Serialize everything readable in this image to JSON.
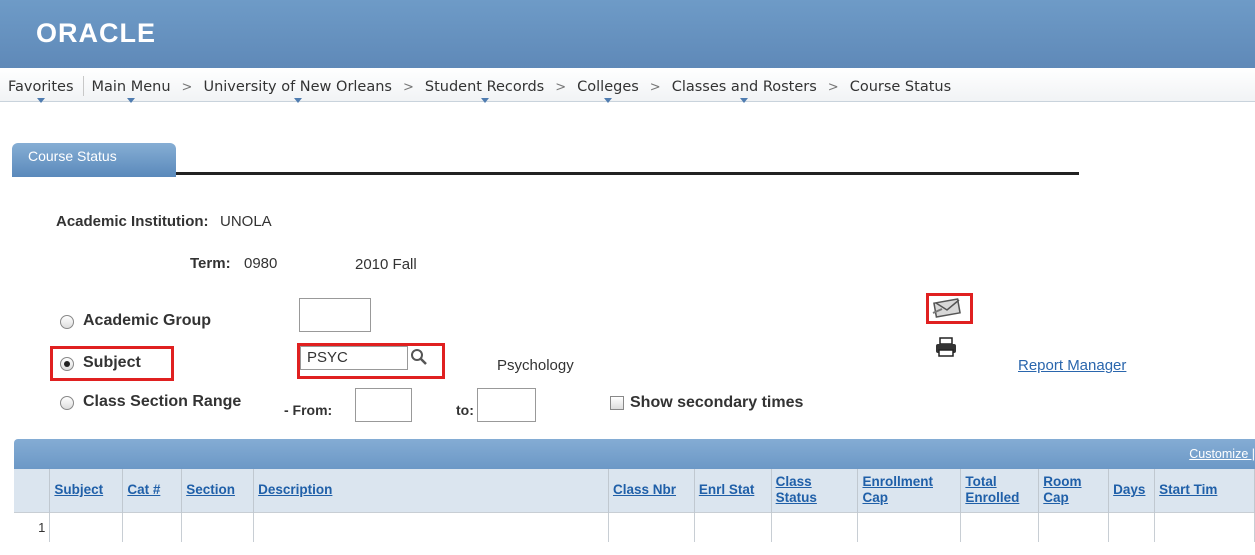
{
  "banner": {
    "logo_text": "ORACLE"
  },
  "nav": {
    "favorites": "Favorites",
    "main_menu": "Main Menu",
    "breadcrumb": [
      "University of New Orleans",
      "Student Records",
      "Colleges",
      "Classes and Rosters",
      "Course Status"
    ],
    "arrow": ">"
  },
  "tab": {
    "label": "Course Status"
  },
  "form": {
    "institution_label": "Academic Institution:",
    "institution_value": "UNOLA",
    "term_label": "Term:",
    "term_code": "0980",
    "term_desc": "2010 Fall",
    "academic_group_label": "Academic Group",
    "subject_label": "Subject",
    "subject_value": "PSYC",
    "subject_desc": "Psychology",
    "class_section_label": "Class Section Range",
    "from_label": "- From:",
    "to_label": "to:",
    "show_secondary_label": "Show secondary times",
    "report_manager_label": "Report Manager",
    "selected_radio": "subject"
  },
  "grid": {
    "customize_label": "Customize |",
    "columns": [
      "Subject",
      "Cat #",
      "Section",
      "Description",
      "Class Nbr",
      "Enrl Stat",
      "Class Status",
      "Enrollment Cap",
      "Total Enrolled",
      "Room Cap",
      "Days",
      "Start Tim"
    ],
    "rows": [
      {
        "num": "1",
        "cells": [
          "",
          "",
          "",
          "",
          "",
          "",
          "",
          "",
          "",
          "",
          "",
          ""
        ]
      }
    ]
  },
  "colors": {
    "banner": "#6e9bc7",
    "highlight": "#e02020",
    "link": "#2a66ad"
  },
  "icons": [
    "search-icon",
    "notify-icon",
    "print-icon",
    "dropdown-caret-icon"
  ]
}
